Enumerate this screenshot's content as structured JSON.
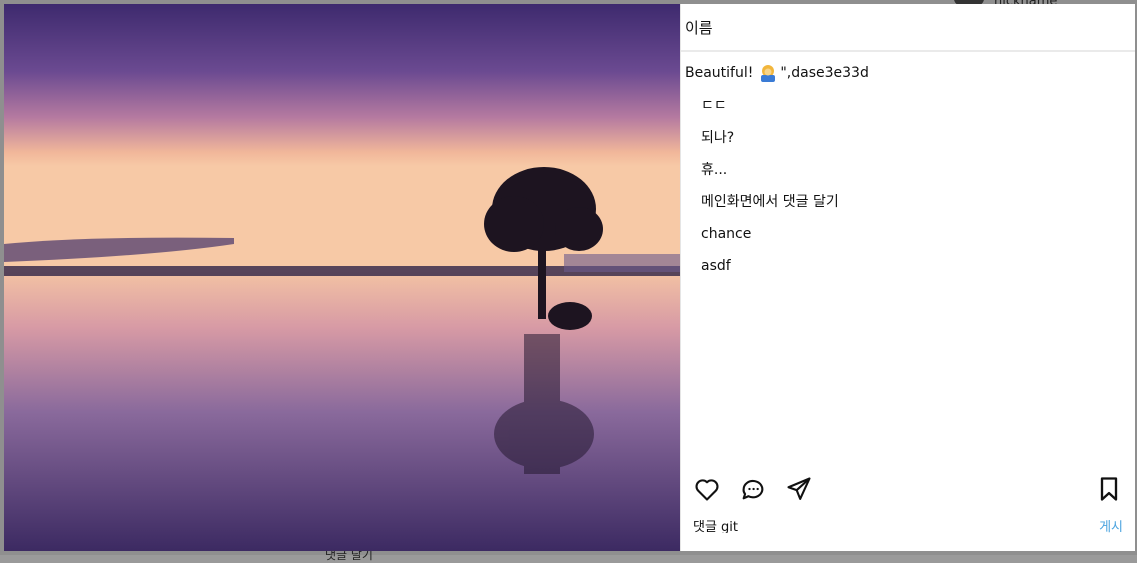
{
  "background": {
    "nickname": "nickname",
    "bottom_text": "댓글 달기"
  },
  "post": {
    "author_name": "이름",
    "caption_text": "Beautiful!",
    "caption_emoji": "person-icon",
    "caption_suffix": "\",dase3e33d",
    "comments": [
      "ㄷㄷ",
      "되나?",
      "휴...",
      "메인화면에서 댓글 달기",
      "chance",
      "asdf"
    ],
    "actions": {
      "like_icon": "heart-icon",
      "comment_icon": "comment-icon",
      "share_icon": "send-icon",
      "bookmark_icon": "bookmark-icon"
    },
    "comment_box": {
      "placeholder": "댓글",
      "value": "댓글 git",
      "post_label": "게시"
    }
  },
  "colors": {
    "accent": "#4aa3df",
    "text": "#111111"
  }
}
